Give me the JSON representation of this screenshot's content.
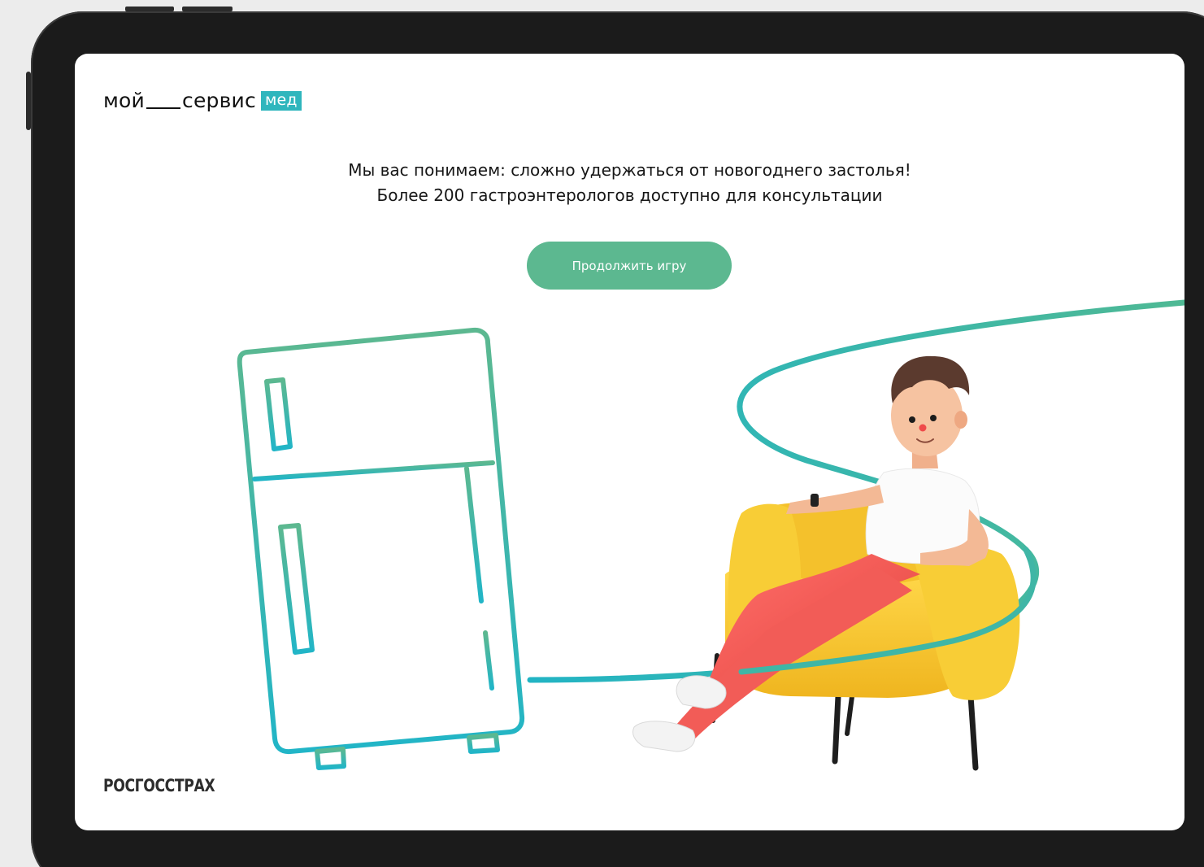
{
  "header": {
    "logo_part1": "мой",
    "logo_part2": "сервис",
    "logo_badge": "мед"
  },
  "message": {
    "line1": "Мы вас понимаем: сложно удержаться от новогоднего застолья!",
    "line2": "Более 200 гастроэнтерологов доступно для консультации"
  },
  "actions": {
    "continue_label": "Продолжить игру"
  },
  "footer": {
    "brand": "РОСГОССТРАХ"
  },
  "icons": [
    "fridge-icon",
    "person-in-armchair-illustration",
    "curved-line-decoration"
  ],
  "colors": {
    "accent_teal": "#2fb6bd",
    "button_green": "#5cb890",
    "line_gradient_start": "#5cb890",
    "line_gradient_end": "#21b5c7",
    "armchair_yellow": "#f6c52d",
    "pants_red": "#ef5654"
  }
}
